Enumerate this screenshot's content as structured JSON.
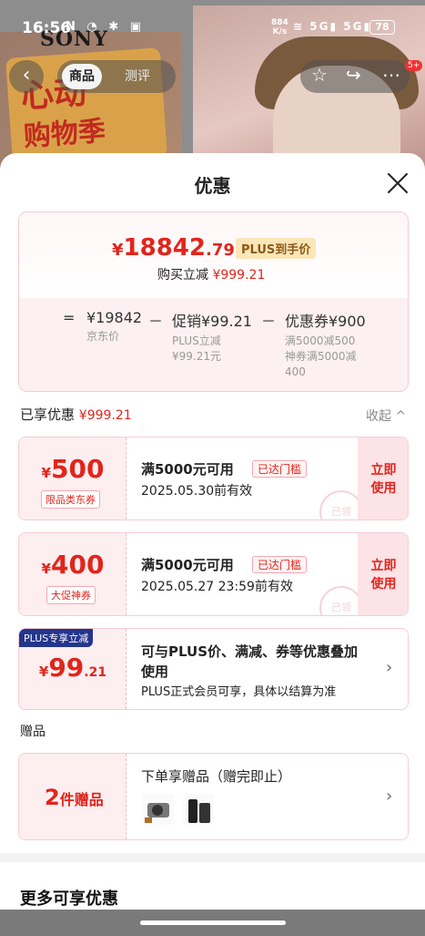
{
  "status_bar": {
    "time": "16:56",
    "net_speed_value": "884",
    "net_speed_unit": "K/s",
    "signal_1": "5G",
    "signal_2": "5G",
    "battery": "78"
  },
  "background": {
    "brand": "SONY",
    "sign_text_1": "心动",
    "sign_text_2": "购物季"
  },
  "top_nav": {
    "tab_product": "商品",
    "tab_review": "测评",
    "badge": "5+"
  },
  "sheet": {
    "title": "优惠"
  },
  "price_card": {
    "currency": "¥",
    "price_int": "18842",
    "price_dec": ".79",
    "plus_tag": "PLUS到手价",
    "reduce_label": "购买立减",
    "reduce_amount": "¥999.21",
    "eq": "=",
    "jd_price": "¥19842",
    "jd_price_label": "京东价",
    "minus1": "－",
    "promo": "促销¥99.21",
    "promo_sub_1": "PLUS立减",
    "promo_sub_2": "¥99.21元",
    "minus2": "－",
    "coupon": "优惠券¥900",
    "coupon_sub_1": "满5000减500",
    "coupon_sub_2": "神券满5000减",
    "coupon_sub_3": "400"
  },
  "enjoyed": {
    "label": "已享优惠",
    "amount": "¥999.21",
    "collapse": "收起 ^"
  },
  "coupons": [
    {
      "yen": "¥",
      "amount": "500",
      "type": "限品类东券",
      "condition": "满5000元可用",
      "reached": "已达门槛",
      "date": "2025.05.30前有效",
      "use_1": "立即",
      "use_2": "使用",
      "stamp": "已领"
    },
    {
      "yen": "¥",
      "amount": "400",
      "type": "大促神券",
      "condition": "满5000元可用",
      "reached": "已达门槛",
      "date": "2025.05.27 23:59前有效",
      "use_1": "立即",
      "use_2": "使用",
      "stamp": "已领"
    }
  ],
  "plus_offer": {
    "badge": "PLUS专享立减",
    "yen": "¥",
    "amount": "99",
    "dec": ".21",
    "text": "可与PLUS价、满减、券等优惠叠加使用",
    "sub": "PLUS正式会员可享，具体以结算为准",
    "arrow": "›"
  },
  "gift": {
    "section": "赠品",
    "count": "2",
    "count_label": "件赠品",
    "title": "下单享赠品（赠完即止）",
    "arrow": "›"
  },
  "more": {
    "title": "更多可享优惠"
  }
}
